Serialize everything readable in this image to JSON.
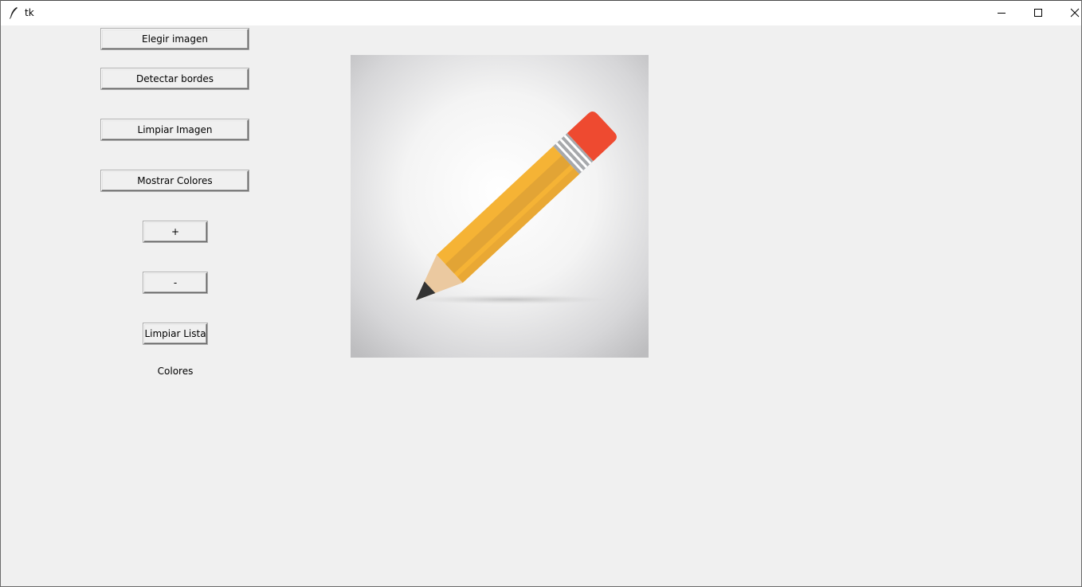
{
  "window": {
    "title": "tk"
  },
  "buttons": {
    "choose_image": "Elegir imagen",
    "detect_edges": "Detectar bordes",
    "clear_image": "Limpiar Imagen",
    "show_colors": "Mostrar Colores",
    "plus": "+",
    "minus": "-",
    "clear_list": "Limpiar Lista"
  },
  "labels": {
    "colors": "Colores"
  },
  "image": {
    "subject": "pencil",
    "colors": {
      "body": "#F5B335",
      "body_shadow": "#E2A435",
      "eraser": "#EE4A30",
      "ferrule": "#A7A9AC",
      "wood": "#EBC9A0",
      "tip": "#333333"
    }
  }
}
